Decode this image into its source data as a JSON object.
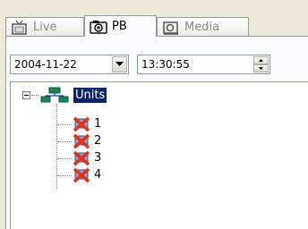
{
  "tabs": [
    {
      "label": "Live",
      "icon": "tv-icon",
      "active": false
    },
    {
      "label": "PB",
      "icon": "camera-icon",
      "active": true
    },
    {
      "label": "Media",
      "icon": "media-icon",
      "active": false
    }
  ],
  "date_picker": {
    "value": "2004-11-22"
  },
  "time_picker": {
    "value": "13:30:55"
  },
  "tree": {
    "root": {
      "label": "Units",
      "icon": "network-icon",
      "expanded": true
    },
    "children": [
      {
        "label": "1",
        "icon": "unit-offline-icon"
      },
      {
        "label": "2",
        "icon": "unit-offline-icon"
      },
      {
        "label": "3",
        "icon": "unit-offline-icon"
      },
      {
        "label": "4",
        "icon": "unit-offline-icon"
      }
    ]
  },
  "colors": {
    "selection": "#0a246a",
    "inactive_tab_text": "#8a8a8a",
    "error_x": "#e0301e"
  }
}
